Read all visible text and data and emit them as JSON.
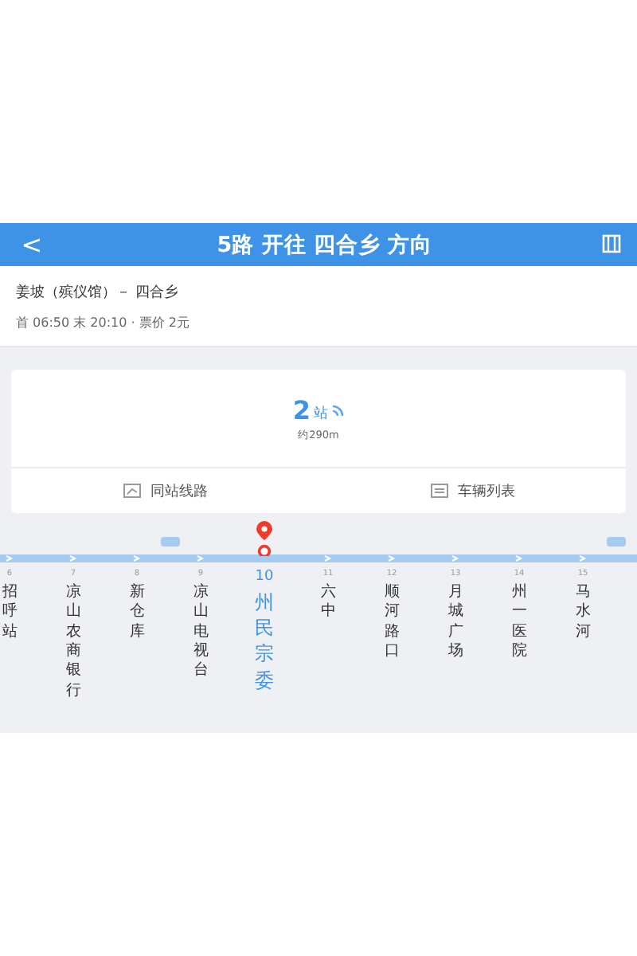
{
  "header": {
    "back": "<",
    "title": "5路 开往 四合乡 方向"
  },
  "route": {
    "ends": "姜坡（殡仪馆）－ 四合乡",
    "schedule": "首 06:50 末 20:10 · 票价 2元"
  },
  "arrival": {
    "count": "2",
    "unit": "站",
    "distance": "约290m"
  },
  "actions": [
    {
      "label": "同站线路",
      "kind": "transfer"
    },
    {
      "label": "车辆列表",
      "kind": "list"
    }
  ],
  "stations": [
    {
      "number": "6",
      "name": "招呼站",
      "selected": false,
      "bus_after": false
    },
    {
      "number": "7",
      "name": "凉山农商银行",
      "selected": false,
      "bus_after": false
    },
    {
      "number": "8",
      "name": "新仓库",
      "selected": false,
      "bus_after": true
    },
    {
      "number": "9",
      "name": "凉山电视台",
      "selected": false,
      "bus_after": false
    },
    {
      "number": "10",
      "name": "州民宗委",
      "selected": true,
      "bus_after": false
    },
    {
      "number": "11",
      "name": "六中",
      "selected": false,
      "bus_after": false
    },
    {
      "number": "12",
      "name": "顺河路口",
      "selected": false,
      "bus_after": false
    },
    {
      "number": "13",
      "name": "月城广场",
      "selected": false,
      "bus_after": false
    },
    {
      "number": "14",
      "name": "州一医院",
      "selected": false,
      "bus_after": false
    },
    {
      "number": "15",
      "name": "马水河",
      "selected": false,
      "bus_after": true
    }
  ]
}
